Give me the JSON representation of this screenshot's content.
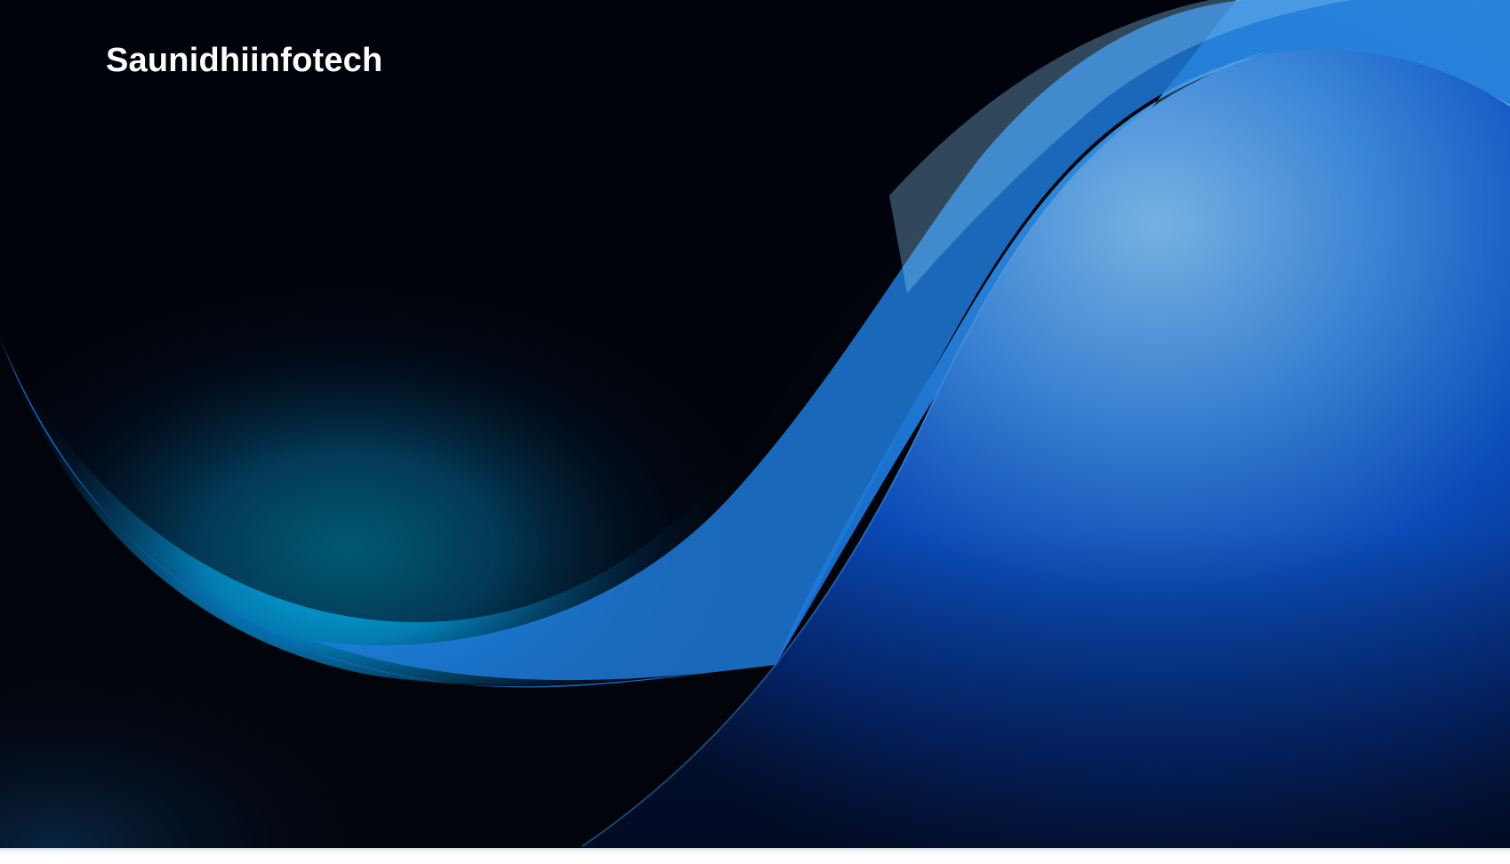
{
  "brand": {
    "name": "Saunidhiinfotech"
  },
  "hero": {
    "background_art": "abstract-blue-wave",
    "colors": {
      "base": "#02040c",
      "cyan": "#00b3e0",
      "blue": "#1f7fe0",
      "light_blue": "#6fb6ee",
      "deep_blue": "#0a3aa8"
    }
  }
}
